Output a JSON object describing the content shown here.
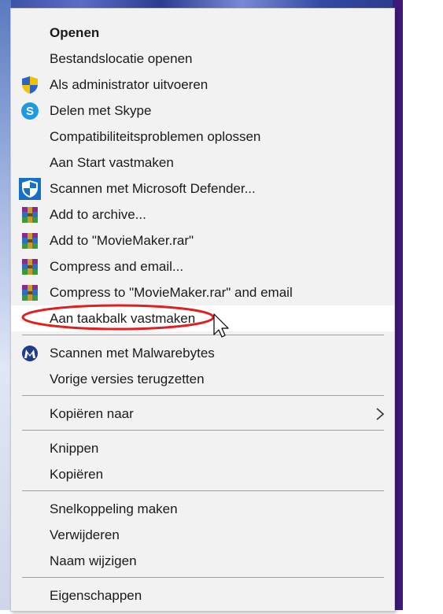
{
  "menu": {
    "items": [
      {
        "label": "Openen",
        "icon": ""
      },
      {
        "label": "Bestandslocatie openen",
        "icon": ""
      },
      {
        "label": "Als administrator uitvoeren",
        "icon": "uac-shield-icon"
      },
      {
        "label": "Delen met Skype",
        "icon": "skype-icon"
      },
      {
        "label": "Compatibiliteitsproblemen oplossen",
        "icon": ""
      },
      {
        "label": "Aan Start vastmaken",
        "icon": ""
      },
      {
        "label": "Scannen met Microsoft Defender...",
        "icon": "defender-shield-icon"
      },
      {
        "label": "Add to archive...",
        "icon": "winrar-icon"
      },
      {
        "label": "Add to \"MovieMaker.rar\"",
        "icon": "winrar-icon"
      },
      {
        "label": "Compress and email...",
        "icon": "winrar-icon"
      },
      {
        "label": "Compress to \"MovieMaker.rar\" and email",
        "icon": "winrar-icon"
      },
      {
        "label": "Aan taakbalk vastmaken",
        "icon": ""
      },
      {
        "label": "Scannen met Malwarebytes",
        "icon": "malwarebytes-icon"
      },
      {
        "label": "Vorige versies terugzetten",
        "icon": ""
      },
      {
        "label": "Kopiëren naar",
        "icon": "chevron-right-icon"
      },
      {
        "label": "Knippen",
        "icon": ""
      },
      {
        "label": "Kopiëren",
        "icon": ""
      },
      {
        "label": "Snelkoppeling maken",
        "icon": ""
      },
      {
        "label": "Verwijderen",
        "icon": ""
      },
      {
        "label": "Naam wijzigen",
        "icon": ""
      },
      {
        "label": "Eigenschappen",
        "icon": ""
      }
    ],
    "highlighted_item": "Aan taakbalk vastmaken",
    "annotation_color": "#e02020",
    "hover_background": "#ffffff",
    "menu_background": "#f2f2f2"
  }
}
